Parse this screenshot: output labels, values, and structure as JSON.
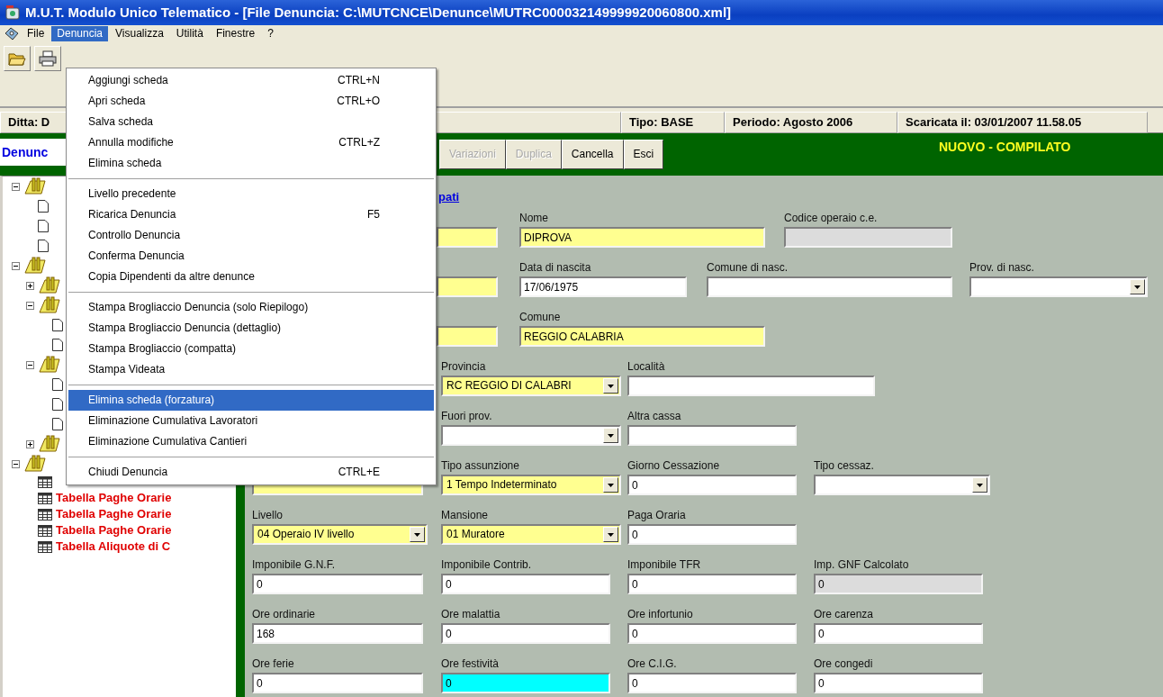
{
  "window": {
    "title": "M.U.T. Modulo Unico Telematico - [File Denuncia: C:\\MUTCNCE\\Denunce\\MUTRC000032149999920060800.xml]"
  },
  "menubar": [
    {
      "label": "File",
      "selected": false
    },
    {
      "label": "Denuncia",
      "selected": true
    },
    {
      "label": "Visualizza",
      "selected": false
    },
    {
      "label": "Utilità",
      "selected": false
    },
    {
      "label": "Finestre",
      "selected": false
    },
    {
      "label": "?",
      "selected": false
    }
  ],
  "menu": {
    "sections": [
      [
        {
          "label": "Aggiungi scheda",
          "shortcut": "CTRL+N",
          "selected": false
        },
        {
          "label": "Apri scheda",
          "shortcut": "CTRL+O",
          "selected": false
        },
        {
          "label": "Salva scheda",
          "selected": false
        },
        {
          "label": "Annulla modifiche",
          "shortcut": "CTRL+Z",
          "selected": false
        },
        {
          "label": "Elimina scheda",
          "selected": false
        }
      ],
      [
        {
          "label": "Livello precedente",
          "selected": false
        },
        {
          "label": "Ricarica Denuncia",
          "shortcut": "F5",
          "selected": false
        },
        {
          "label": "Controllo Denuncia",
          "selected": false
        },
        {
          "label": "Conferma Denuncia",
          "selected": false
        },
        {
          "label": "Copia Dipendenti da altre denunce",
          "selected": false
        }
      ],
      [
        {
          "label": "Stampa Brogliaccio Denuncia (solo Riepilogo)",
          "selected": false
        },
        {
          "label": "Stampa Brogliaccio Denuncia (dettaglio)",
          "selected": false
        },
        {
          "label": "Stampa Brogliaccio (compatta)",
          "selected": false
        },
        {
          "label": "Stampa Videata",
          "selected": false
        }
      ],
      [
        {
          "label": "Elimina scheda (forzatura)",
          "selected": true
        },
        {
          "label": "Eliminazione Cumulativa Lavoratori",
          "selected": false
        },
        {
          "label": "Eliminazione Cumulativa Cantieri",
          "selected": false
        }
      ],
      [
        {
          "label": "Chiudi Denuncia",
          "shortcut": "CTRL+E",
          "selected": false
        }
      ]
    ]
  },
  "info_bar": [
    "Ditta: D",
    "Tipo: BASE",
    "Periodo: Agosto 2006",
    "Scaricata il: 03/01/2007 11.58.05"
  ],
  "action_bar": {
    "tab": "Denunc",
    "buttons": [
      {
        "label": "Variazioni",
        "disabled": true
      },
      {
        "label": "Duplica",
        "disabled": true
      },
      {
        "label": "Cancella",
        "disabled": false
      },
      {
        "label": "Esci",
        "disabled": false
      }
    ],
    "status": "NUOVO - COMPILATO"
  },
  "tree": [
    {
      "kind": "folder",
      "expanded": true,
      "children": [
        {
          "kind": "doc"
        },
        {
          "kind": "doc"
        },
        {
          "kind": "doc"
        }
      ]
    },
    {
      "kind": "folder",
      "expanded": true,
      "children": [
        {
          "kind": "folder",
          "expanded": false
        },
        {
          "kind": "folder",
          "expanded": true,
          "children": [
            {
              "kind": "doc"
            },
            {
              "kind": "doc"
            }
          ]
        },
        {
          "kind": "folder",
          "expanded": true,
          "children": [
            {
              "kind": "doc"
            },
            {
              "kind": "doc"
            },
            {
              "kind": "doc"
            }
          ]
        },
        {
          "kind": "folder",
          "expanded": false
        }
      ]
    },
    {
      "kind": "folder",
      "expanded": true,
      "children": [
        {
          "kind": "table"
        },
        {
          "kind": "table",
          "label": "Tabella Paghe Orarie"
        },
        {
          "kind": "table",
          "label": "Tabella Paghe Orarie"
        },
        {
          "kind": "table",
          "label": "Tabella Paghe Orarie"
        },
        {
          "kind": "table",
          "label": "Tabella Aliquote di C"
        }
      ]
    }
  ],
  "form": {
    "link": "pati",
    "groups": [
      {
        "fields": [
          {
            "kind": "text",
            "required": true,
            "disabled": false,
            "focused": false
          },
          {
            "kind": "text",
            "label": "Nome",
            "value": "DIPROVA",
            "required": true,
            "disabled": false,
            "focused": false
          },
          {
            "kind": "text",
            "label": "Codice operaio c.e.",
            "required": false,
            "disabled": true,
            "focused": false
          }
        ]
      },
      {
        "fields": [
          {
            "kind": "text",
            "required": true,
            "disabled": false,
            "focused": false
          },
          {
            "kind": "text",
            "label": "Data di nascita",
            "value": "17/06/1975",
            "required": false,
            "disabled": false,
            "focused": false
          },
          {
            "kind": "text",
            "label": "Comune di nasc.",
            "required": false,
            "disabled": false,
            "focused": false
          },
          {
            "kind": "select",
            "label": "Prov. di nasc.",
            "required": false,
            "disabled": false,
            "focused": false
          }
        ]
      },
      {
        "fields": [
          {
            "kind": "text",
            "required": true,
            "disabled": false,
            "focused": false
          },
          {
            "kind": "text",
            "label": "Comune",
            "value": "REGGIO CALABRIA",
            "required": true,
            "disabled": false,
            "focused": false
          }
        ]
      },
      {
        "fields": [
          {
            "kind": "select",
            "label": "Provincia",
            "value": "RC REGGIO DI CALABRI",
            "required": true,
            "disabled": false,
            "focused": false
          },
          {
            "kind": "text",
            "label": "Località",
            "required": false,
            "disabled": false,
            "focused": false
          }
        ]
      },
      {
        "fields": [
          {
            "kind": "select",
            "label": "Fuori prov.",
            "required": false,
            "disabled": false,
            "focused": false
          },
          {
            "kind": "text",
            "label": "Altra cassa",
            "required": false,
            "disabled": false,
            "focused": false
          }
        ]
      },
      {
        "fields": [
          {
            "kind": "text",
            "required": true,
            "disabled": false,
            "focused": false
          },
          {
            "kind": "select",
            "label": "Tipo assunzione",
            "value": "1 Tempo Indeterminato",
            "required": true,
            "disabled": false,
            "focused": false
          },
          {
            "kind": "text",
            "label": "Giorno Cessazione",
            "value": "0",
            "required": false,
            "disabled": false,
            "focused": false
          },
          {
            "kind": "select",
            "label": "Tipo cessaz.",
            "required": false,
            "disabled": false,
            "focused": false
          }
        ]
      },
      {
        "fields": [
          {
            "kind": "select",
            "label": "Livello",
            "value": "04 Operaio IV livello",
            "required": true,
            "disabled": false,
            "focused": false
          },
          {
            "kind": "select",
            "label": "Mansione",
            "value": "01 Muratore",
            "required": true,
            "disabled": false,
            "focused": false
          },
          {
            "kind": "text",
            "label": "Paga Oraria",
            "value": "0",
            "required": false,
            "disabled": false,
            "focused": false
          }
        ]
      },
      {
        "fields": [
          {
            "kind": "text",
            "label": "Imponibile G.N.F.",
            "value": "0",
            "required": false,
            "disabled": false,
            "focused": false
          },
          {
            "kind": "text",
            "label": "Imponibile Contrib.",
            "value": "0",
            "required": false,
            "disabled": false,
            "focused": false
          },
          {
            "kind": "text",
            "label": "Imponibile TFR",
            "value": "0",
            "required": false,
            "disabled": false,
            "focused": false
          },
          {
            "kind": "text",
            "label": "Imp. GNF Calcolato",
            "value": "0",
            "required": false,
            "disabled": true,
            "focused": false
          }
        ]
      },
      {
        "fields": [
          {
            "kind": "text",
            "label": "Ore ordinarie",
            "value": "168",
            "required": false,
            "disabled": false,
            "focused": false
          },
          {
            "kind": "text",
            "label": "Ore malattia",
            "value": "0",
            "required": false,
            "disabled": false,
            "focused": false
          },
          {
            "kind": "text",
            "label": "Ore infortunio",
            "value": "0",
            "required": false,
            "disabled": false,
            "focused": false
          },
          {
            "kind": "text",
            "label": "Ore carenza",
            "value": "0",
            "required": false,
            "disabled": false,
            "focused": false
          }
        ]
      },
      {
        "fields": [
          {
            "kind": "text",
            "label": "Ore ferie",
            "value": "0",
            "required": false,
            "disabled": false,
            "focused": false
          },
          {
            "kind": "text",
            "label": "Ore festività",
            "value": "0",
            "required": false,
            "disabled": false,
            "focused": true
          },
          {
            "kind": "text",
            "label": "Ore C.I.G.",
            "value": "0",
            "required": false,
            "disabled": false,
            "focused": false
          },
          {
            "kind": "text",
            "label": "Ore congedi",
            "value": "0",
            "required": false,
            "disabled": false,
            "focused": false
          }
        ]
      }
    ]
  }
}
